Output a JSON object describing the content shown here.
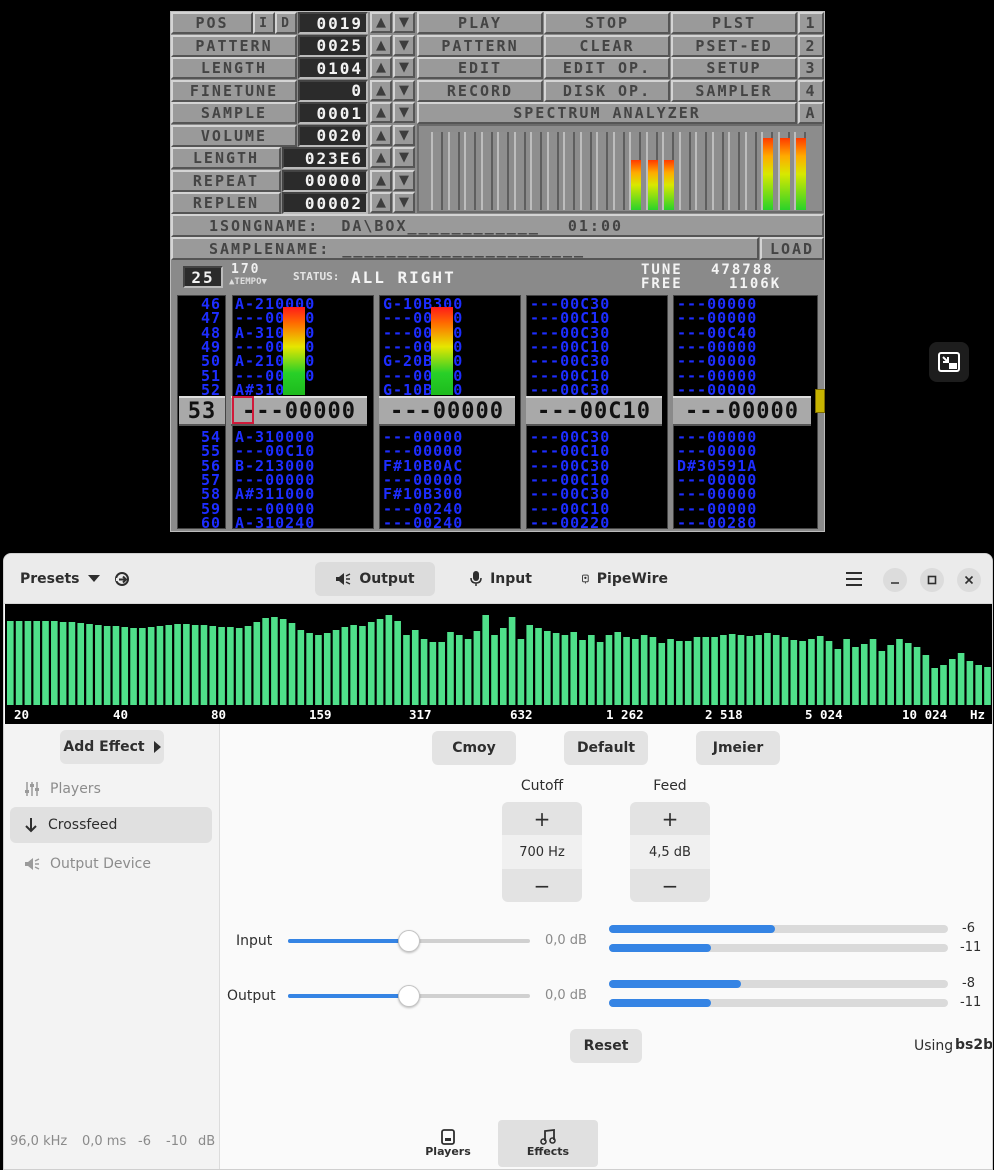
{
  "tracker": {
    "rows_left": [
      {
        "label": "POS",
        "value": "0019"
      },
      {
        "label": "PATTERN",
        "value": "0025"
      },
      {
        "label": "LENGTH",
        "value": "0104"
      },
      {
        "label": "FINETUNE",
        "value": "0"
      },
      {
        "label": "SAMPLE",
        "value": "0001"
      },
      {
        "label": "VOLUME",
        "value": "0020"
      },
      {
        "label": "LENGTH",
        "value": "023E6"
      },
      {
        "label": "REPEAT",
        "value": "00000"
      },
      {
        "label": "REPLEN",
        "value": "00002"
      }
    ],
    "pos_extra": [
      "I",
      "D"
    ],
    "buttons": [
      [
        "PLAY",
        "STOP",
        "PLST"
      ],
      [
        "PATTERN",
        "CLEAR",
        "PSET-ED"
      ],
      [
        "EDIT",
        "EDIT OP.",
        "SETUP"
      ],
      [
        "RECORD",
        "DISK OP.",
        "SAMPLER"
      ]
    ],
    "side_numbers": [
      "1",
      "2",
      "3",
      "4",
      "A"
    ],
    "spectrum_title": "SPECTRUM ANALYZER",
    "songname_label": "1SONGNAME:",
    "songname": "DA\\BOX____________",
    "song_time": "01:00",
    "samplename_label": "SAMPLENAME:",
    "samplename": "______________________",
    "load_label": "LOAD",
    "pattern_num": "25",
    "tempo": "170",
    "tempo_label": "▲TEMPO▼",
    "status_label": "STATUS:",
    "status": "ALL RIGHT",
    "tune_label": "TUNE",
    "tune_value": "478788",
    "free_label": "FREE",
    "free_value": "1106K",
    "row_numbers_above": [
      "46",
      "47",
      "48",
      "49",
      "50",
      "51",
      "52"
    ],
    "current_row": "53",
    "row_numbers_below": [
      "54",
      "55",
      "56",
      "57",
      "58",
      "59",
      "60"
    ],
    "channels": [
      {
        "above": [
          "A-210000",
          "---00C10",
          "A-310000",
          "---00C10",
          "A-210000",
          "---00C10",
          "A#31000"
        ],
        "current": "---00000",
        "below": [
          "A-310000",
          "---00C10",
          "B-213000",
          "---00000",
          "A#311000",
          "---00000",
          "A-310240"
        ]
      },
      {
        "above": [
          "G-10B300",
          "---00000",
          "---00000",
          "---00000",
          "G-20B300",
          "---00000",
          "G-10B300"
        ],
        "current": "---00000",
        "below": [
          "---00000",
          "---00000",
          "F#10B0AC",
          "---00000",
          "F#10B300",
          "---00240",
          "---00240"
        ]
      },
      {
        "above": [
          "---00C30",
          "---00C10",
          "---00C30",
          "---00C10",
          "---00C30",
          "---00C10",
          "---00C30"
        ],
        "current": "---00C10",
        "below": [
          "---00C30",
          "---00C10",
          "---00C30",
          "---00C10",
          "---00C30",
          "---00C10",
          "---00220"
        ]
      },
      {
        "above": [
          "---00000",
          "---00000",
          "---00C40",
          "---00000",
          "---00000",
          "---00000",
          "---00000"
        ],
        "current": "---00000",
        "below": [
          "---00000",
          "---00000",
          "D#30591A",
          "---00000",
          "---00000",
          "---00000",
          "---00280"
        ]
      }
    ]
  },
  "header": {
    "presets_label": "Presets",
    "tabs": [
      {
        "label": "Output",
        "icon": "speaker-icon",
        "active": true
      },
      {
        "label": "Input",
        "icon": "microphone-icon",
        "active": false
      },
      {
        "label": "PipeWire",
        "icon": "pipewire-icon",
        "active": false
      }
    ]
  },
  "spectrum": {
    "freq_labels": [
      "20",
      "40",
      "80",
      "159",
      "317",
      "632",
      "1 262",
      "2 518",
      "5 024",
      "10 024",
      "Hz"
    ],
    "bar_levels": [
      0.84,
      0.84,
      0.84,
      0.84,
      0.84,
      0.84,
      0.83,
      0.83,
      0.82,
      0.81,
      0.8,
      0.79,
      0.79,
      0.78,
      0.77,
      0.77,
      0.78,
      0.79,
      0.8,
      0.81,
      0.81,
      0.8,
      0.8,
      0.79,
      0.78,
      0.78,
      0.77,
      0.79,
      0.83,
      0.87,
      0.88,
      0.86,
      0.82,
      0.75,
      0.72,
      0.7,
      0.72,
      0.75,
      0.78,
      0.8,
      0.79,
      0.83,
      0.86,
      0.9,
      0.84,
      0.7,
      0.75,
      0.66,
      0.63,
      0.63,
      0.73,
      0.7,
      0.66,
      0.74,
      0.9,
      0.7,
      0.77,
      0.88,
      0.66,
      0.8,
      0.77,
      0.74,
      0.72,
      0.7,
      0.73,
      0.65,
      0.7,
      0.63,
      0.7,
      0.73,
      0.68,
      0.66,
      0.7,
      0.68,
      0.62,
      0.66,
      0.64,
      0.64,
      0.68,
      0.68,
      0.68,
      0.7,
      0.71,
      0.7,
      0.69,
      0.7,
      0.72,
      0.7,
      0.68,
      0.65,
      0.64,
      0.66,
      0.69,
      0.64,
      0.56,
      0.66,
      0.58,
      0.61,
      0.66,
      0.54,
      0.6,
      0.66,
      0.62,
      0.58,
      0.5,
      0.37,
      0.4,
      0.46,
      0.52,
      0.44,
      0.4,
      0.38
    ],
    "bar_color": "#4fe08a"
  },
  "sidebar": {
    "add_effect": "Add Effect",
    "items": [
      {
        "label": "Players",
        "icon": "equalizer-icon",
        "state": "dim"
      },
      {
        "label": "Crossfeed",
        "icon": "arrow-down-icon",
        "state": "sel"
      },
      {
        "label": "Output Device",
        "icon": "speaker-icon",
        "state": "dim"
      }
    ],
    "status": {
      "rate": "96,0 kHz",
      "latency": "0,0 ms",
      "left": "-6",
      "right": "-10",
      "unit": "dB"
    }
  },
  "crossfeed": {
    "presets": [
      "Cmoy",
      "Default",
      "Jmeier"
    ],
    "cutoff": {
      "label": "Cutoff",
      "value": "700 Hz",
      "plus": "+",
      "minus": "−"
    },
    "feed": {
      "label": "Feed",
      "value": "4,5 dB",
      "plus": "+",
      "minus": "−"
    },
    "input": {
      "label": "Input",
      "value": "0,0 dB",
      "slider": 0.5,
      "meters": [
        {
          "fraction": 0.49,
          "label": "-6"
        },
        {
          "fraction": 0.3,
          "label": "-11"
        }
      ]
    },
    "output": {
      "label": "Output",
      "value": "0,0 dB",
      "slider": 0.5,
      "meters": [
        {
          "fraction": 0.39,
          "label": "-8"
        },
        {
          "fraction": 0.3,
          "label": "-11"
        }
      ]
    },
    "reset": "Reset",
    "using_label": "Using",
    "using_value": "bs2b"
  },
  "view_switcher": [
    {
      "label": "Players",
      "icon": "player-icon",
      "active": false
    },
    {
      "label": "Effects",
      "icon": "music-note-icon",
      "active": true
    }
  ],
  "colors": {
    "accent": "#3584e4",
    "tracker_text": "#1d2dff"
  }
}
